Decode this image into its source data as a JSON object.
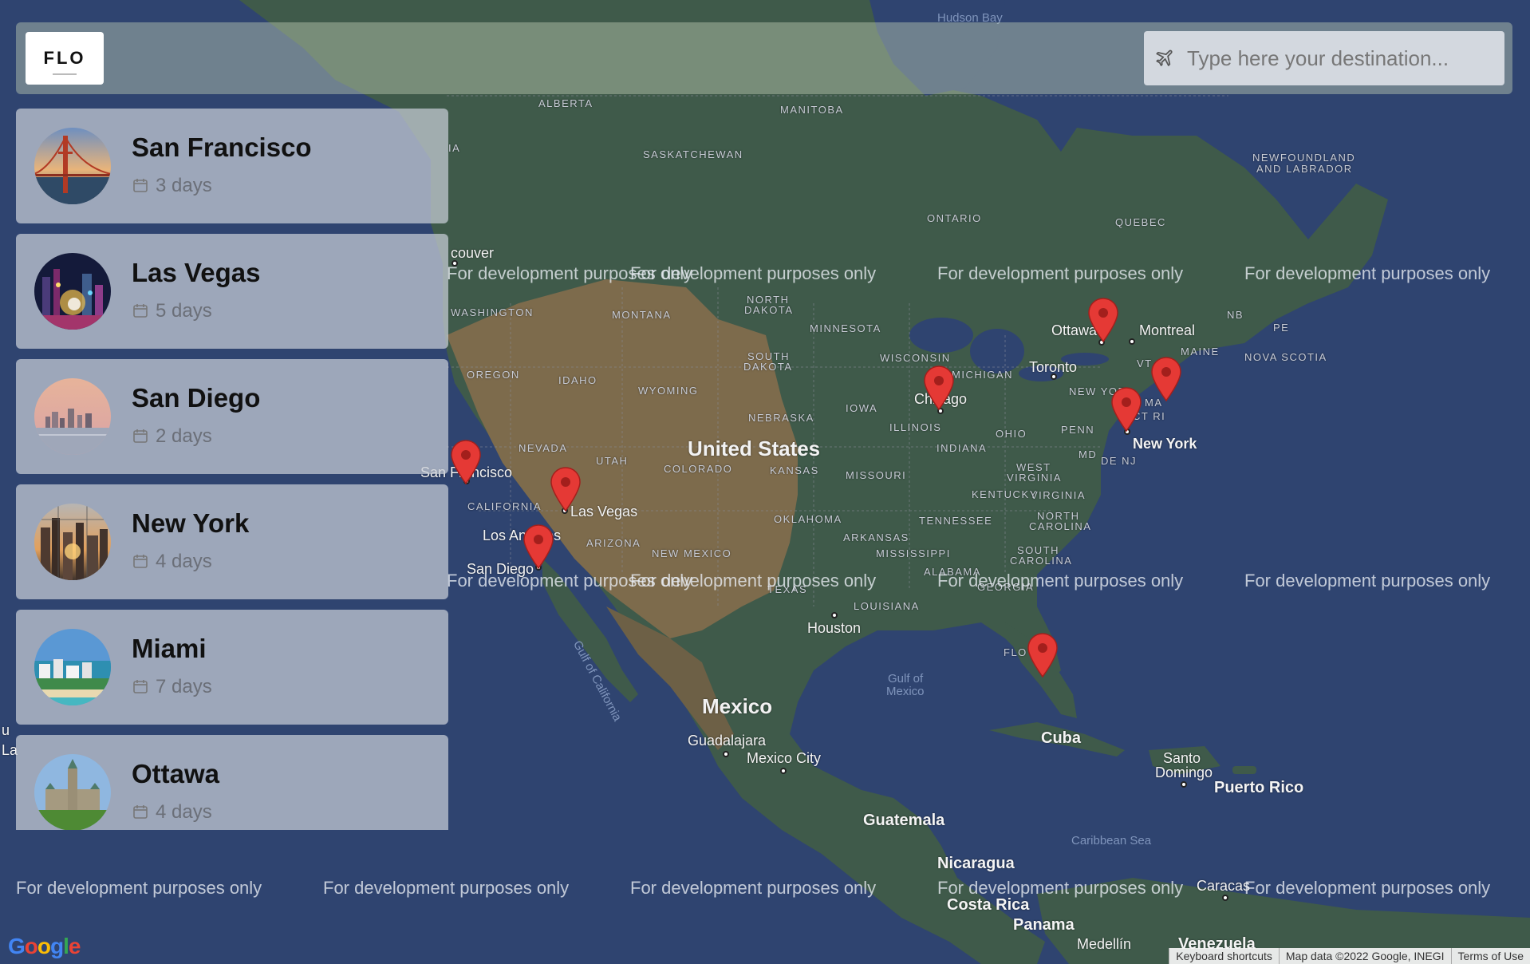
{
  "app": {
    "logo_text": "FLO",
    "search": {
      "placeholder": "Type here your destination...",
      "icon": "plane-icon"
    }
  },
  "destinations": [
    {
      "name": "San Francisco",
      "days": "3 days",
      "image": "golden-gate-bridge"
    },
    {
      "name": "Las Vegas",
      "days": "5 days",
      "image": "las-vegas-strip"
    },
    {
      "name": "San Diego",
      "days": "2 days",
      "image": "san-diego-skyline"
    },
    {
      "name": "New York",
      "days": "4 days",
      "image": "new-york-skyline"
    },
    {
      "name": "Miami",
      "days": "7 days",
      "image": "miami-beach"
    },
    {
      "name": "Ottawa",
      "days": "4 days",
      "image": "parliament-hill"
    }
  ],
  "map": {
    "watermark": "For development purposes only",
    "colors": {
      "ocean": "#2f4470",
      "land": "#3f5a4a",
      "desert": "#7d6b4c",
      "marker": "#e53935"
    },
    "labels": {
      "hudson_bay": "Hudson Bay",
      "alberta": "ALBERTA",
      "manitoba": "MANITOBA",
      "saskatchewan": "SASKATCHEWAN",
      "newfoundland_1": "NEWFOUNDLAND",
      "newfoundland_2": "AND LABRADOR",
      "ontario": "ONTARIO",
      "quebec": "QUEBEC",
      "vancouver": "couver",
      "bc": "IA",
      "washington": "WASHINGTON",
      "montana": "MONTANA",
      "north_dakota_1": "NORTH",
      "north_dakota_2": "DAKOTA",
      "minnesota": "MINNESOTA",
      "ottawa": "Ottawa",
      "montreal": "Montreal",
      "nb": "NB",
      "pe": "PE",
      "maine": "MAINE",
      "nova_scotia": "NOVA SCOTIA",
      "oregon": "OREGON",
      "idaho": "IDAHO",
      "wyoming": "WYOMING",
      "south_dakota_1": "SOUTH",
      "south_dakota_2": "DAKOTA",
      "wisconsin": "WISCONSIN",
      "michigan": "MICHIGAN",
      "toronto": "Toronto",
      "vt": "VT",
      "new_york_state": "NEW YOR",
      "ma": "MA",
      "ct_ri": "CT RI",
      "chicago": "Chicago",
      "iowa": "IOWA",
      "nebraska": "NEBRASKA",
      "illinois": "ILLINOIS",
      "ohio": "OHIO",
      "penn": "PENN",
      "nevada": "NEVADA",
      "utah": "UTAH",
      "united_states": "United States",
      "colorado": "COLORADO",
      "kansas": "KANSAS",
      "missouri": "MISSOURI",
      "indiana": "INDIANA",
      "west_virginia_1": "WEST",
      "west_virginia_2": "VIRGINIA",
      "md": "MD",
      "de_nj": "DE NJ",
      "new_york_city": "New York",
      "san_francisco": "San Francisco",
      "las_vegas": "Las Vegas",
      "california": "CALIFORNIA",
      "kentucky": "KENTUCKY",
      "virginia": "VIRGINIA",
      "los_angeles": "Los Angeles",
      "arizona": "ARIZONA",
      "oklahoma": "OKLAHOMA",
      "tennessee": "TENNESSEE",
      "north_carolina_1": "NORTH",
      "north_carolina_2": "CAROLINA",
      "san_diego": "San Diego",
      "new_mexico": "NEW MEXICO",
      "arkansas": "ARKANSAS",
      "mississippi": "MISSISSIPPI",
      "south_carolina_1": "SOUTH",
      "south_carolina_2": "CAROLINA",
      "alabama": "ALABAMA",
      "georgia": "GEORGIA",
      "texas": "TEXAS",
      "louisiana": "LOUISIANA",
      "houston": "Houston",
      "gulf_of_california": "Gulf of California",
      "gulf_of_mexico_1": "Gulf of",
      "gulf_of_mexico_2": "Mexico",
      "florida": "FLO",
      "mexico": "Mexico",
      "cuba": "Cuba",
      "guadalajara": "Guadalajara",
      "mexico_city": "Mexico City",
      "santo_domingo_1": "Santo",
      "santo_domingo_2": "Domingo",
      "puerto_rico": "Puerto Rico",
      "guatemala": "Guatemala",
      "caribbean_sea": "Caribbean Sea",
      "nicaragua": "Nicaragua",
      "caracas": "Caracas",
      "costa_rica": "Costa Rica",
      "panama": "Panama",
      "medellin": "Medellín",
      "venezuela": "Venezuela",
      "la": "La",
      "u": "u"
    },
    "markers": [
      "San Francisco",
      "Las Vegas",
      "San Diego",
      "Chicago",
      "Ottawa",
      "New York",
      "Boston",
      "Miami"
    ]
  },
  "footer": {
    "google_logo": "Google",
    "keyboard_shortcuts": "Keyboard shortcuts",
    "map_data": "Map data ©2022 Google, INEGI",
    "terms": "Terms of Use"
  }
}
